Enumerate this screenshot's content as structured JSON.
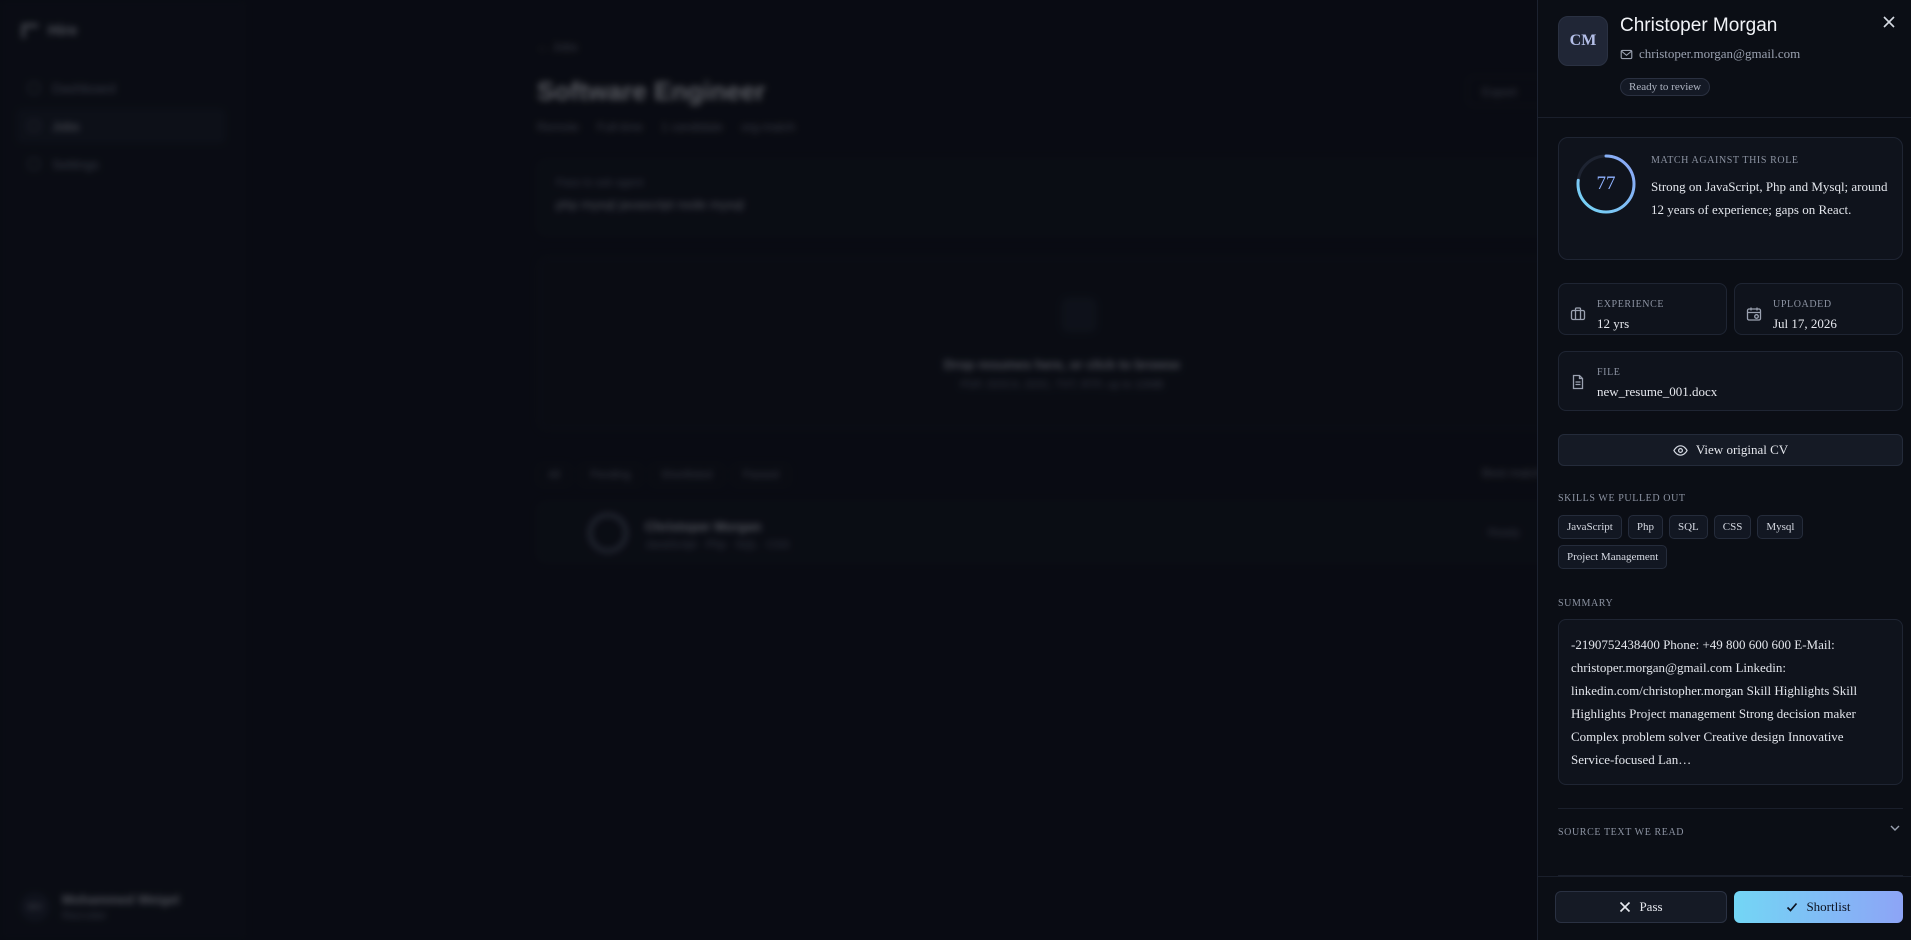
{
  "background": {
    "brand": "Hire",
    "nav": [
      {
        "label": "Dashboard",
        "active": false
      },
      {
        "label": "Jobs",
        "active": true
      },
      {
        "label": "Settings",
        "active": false
      }
    ],
    "user": {
      "initials": "MV",
      "name": "Mohammed Weigel",
      "role": "Recruiter"
    },
    "breadcrumb": "Jobs",
    "job_title": "Software Engineer",
    "job_meta": [
      "Remote",
      "Full-time",
      "1 candidate",
      "org-match"
    ],
    "export_label": "Export",
    "prompt_label": "Pass to ask agent",
    "prompt_value": "php mysql javascript node mysql",
    "drop_title": "Drop resumes here, or click to browse",
    "drop_sub": "PDF, DOCX, DOC, TXT, RTF, up to 10MB",
    "filters": [
      "All",
      "Pending",
      "Shortlisted",
      "Passed"
    ],
    "sort_label": "Best match",
    "row": {
      "name": "Christoper Morgan",
      "skills": "JavaScript · Php · SQL · CSS",
      "status": "Ready"
    }
  },
  "drawer": {
    "avatar_initials": "CM",
    "name": "Christoper Morgan",
    "email": "christoper.morgan@gmail.com",
    "status": "Ready to review",
    "close_icon": "close-icon",
    "match": {
      "score": 77,
      "label": "MATCH AGAINST THIS ROLE",
      "text": "Strong on JavaScript, Php and Mysql; around 12 years of experience; gaps on React."
    },
    "experience": {
      "label": "EXPERIENCE",
      "value": "12 yrs"
    },
    "uploaded": {
      "label": "UPLOADED",
      "value": "Jul 17, 2026"
    },
    "file": {
      "label": "FILE",
      "value": "new_resume_001.docx"
    },
    "view_cv_label": "View original CV",
    "skills_label": "SKILLS WE PULLED OUT",
    "skills": [
      "JavaScript",
      "Php",
      "SQL",
      "CSS",
      "Mysql",
      "Project Management"
    ],
    "summary_label": "SUMMARY",
    "summary": "-2190752438400 Phone: +49 800 600 600 E-Mail: christoper.morgan@gmail.com Linkedin: linkedin.com/christopher.morgan Skill Highlights Skill Highlights Project management Strong decision maker Complex problem solver Creative design Innovative Service-focused Lan…",
    "source_label": "SOURCE TEXT WE READ",
    "pass_label": "Pass",
    "shortlist_label": "Shortlist",
    "colors": {
      "accent_from": "#73d6f5",
      "accent_to": "#8da4f6",
      "ring": "#8fb2ff"
    }
  }
}
